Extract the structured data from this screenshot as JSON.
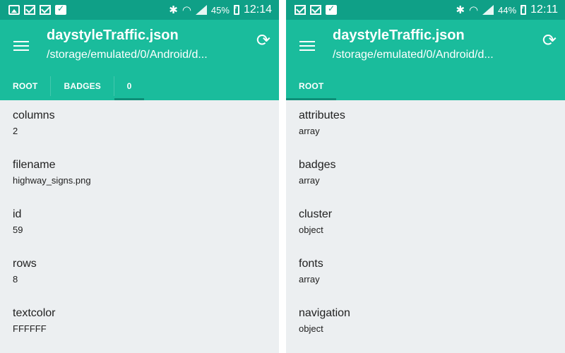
{
  "colors": {
    "statusbar": "#0fa087",
    "appbar": "#1abc9c",
    "tab_indicator": "#0e8f78",
    "list_bg": "#eceff1"
  },
  "left": {
    "status": {
      "battery": "45%",
      "time": "12:14"
    },
    "title": "daystyleTraffic.json",
    "subtitle": "/storage/emulated/0/Android/d...",
    "tabs": [
      {
        "label": "ROOT"
      },
      {
        "label": "BADGES"
      },
      {
        "label": "0",
        "active": true
      }
    ],
    "items": [
      {
        "key": "columns",
        "value": "2"
      },
      {
        "key": "filename",
        "value": "highway_signs.png"
      },
      {
        "key": "id",
        "value": "59"
      },
      {
        "key": "rows",
        "value": "8"
      },
      {
        "key": "textcolor",
        "value": "FFFFFF"
      }
    ]
  },
  "right": {
    "status": {
      "battery": "44%",
      "time": "12:11"
    },
    "title": "daystyleTraffic.json",
    "subtitle": "/storage/emulated/0/Android/d...",
    "tabs": [
      {
        "label": "ROOT",
        "active": true
      }
    ],
    "items": [
      {
        "key": "attributes",
        "value": "array"
      },
      {
        "key": "badges",
        "value": "array"
      },
      {
        "key": "cluster",
        "value": "object"
      },
      {
        "key": "fonts",
        "value": "array"
      },
      {
        "key": "navigation",
        "value": "object"
      }
    ]
  },
  "icons": {
    "status_left": [
      "image-icon",
      "mail-check-icon",
      "mail-icon",
      "clipboard-check-icon"
    ],
    "status_right": [
      "bluetooth-icon",
      "wifi-icon",
      "signal-icon",
      "battery-charging-icon"
    ],
    "menu": "hamburger-menu-icon",
    "refresh": "refresh-icon"
  }
}
